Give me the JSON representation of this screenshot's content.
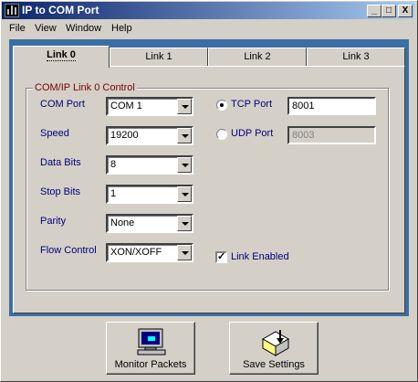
{
  "window": {
    "title": "IP to COM Port"
  },
  "title_buttons": {
    "minimize": "_",
    "maximize": "□",
    "close": "X"
  },
  "menu": [
    {
      "label": "File"
    },
    {
      "label": "View"
    },
    {
      "label": "Window"
    },
    {
      "label": "Help"
    }
  ],
  "tabs": [
    {
      "label": "Link 0",
      "active": true
    },
    {
      "label": "Link 1",
      "active": false
    },
    {
      "label": "Link 2",
      "active": false
    },
    {
      "label": "Link 3",
      "active": false
    }
  ],
  "group": {
    "title": "COM/IP Link 0 Control",
    "com_port": {
      "label": "COM Port",
      "value": "COM 1"
    },
    "speed": {
      "label": "Speed",
      "value": "19200"
    },
    "data_bits": {
      "label": "Data Bits",
      "value": "8"
    },
    "stop_bits": {
      "label": "Stop Bits",
      "value": "1"
    },
    "parity": {
      "label": "Parity",
      "value": "None"
    },
    "flow_control": {
      "label": "Flow Control",
      "value": "XON/XOFF"
    },
    "tcp_port": {
      "label": "TCP Port",
      "value": "8001",
      "selected": true
    },
    "udp_port": {
      "label": "UDP Port",
      "value": "8003",
      "selected": false
    },
    "link_enabled": {
      "label": "Link Enabled",
      "checked": true,
      "mark": "✓"
    }
  },
  "buttons": {
    "monitor": {
      "label": "Monitor Packets",
      "icon": "computer-monitor-icon"
    },
    "save": {
      "label": "Save Settings",
      "icon": "save-settings-icon"
    }
  },
  "colors": {
    "title_start": "#0a246a",
    "title_end": "#a6caf0",
    "client_bg": "#3a6ea5",
    "label_blue": "#00007a",
    "group_title": "#7a0000"
  }
}
